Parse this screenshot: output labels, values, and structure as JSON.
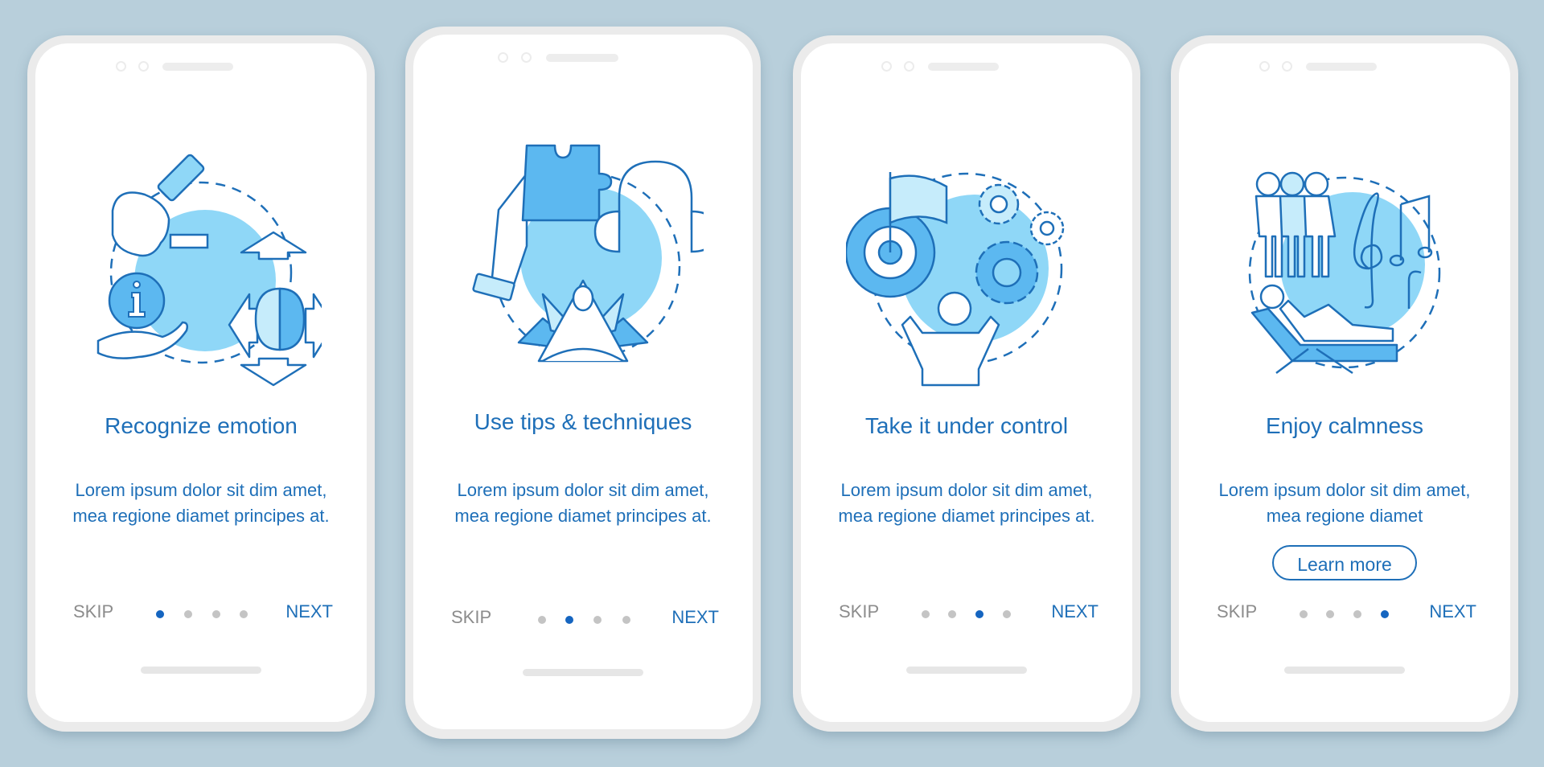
{
  "colors": {
    "background": "#b8cfdb",
    "accent": "#1e6fb8",
    "active_dot": "#1565c0",
    "inactive_dot": "#c4c4c4",
    "skip": "#8c8c8c",
    "illustration_fill": "#8fd7f7",
    "illustration_mid": "#5cb8f0"
  },
  "screens": [
    {
      "illustration": "recognize-emotion-illustration",
      "title": "Recognize emotion",
      "description": "Lorem ipsum dolor sit dim amet, mea regione diamet principes at.",
      "skip_label": "SKIP",
      "next_label": "NEXT",
      "page_index": 1,
      "page_count": 4
    },
    {
      "illustration": "tips-techniques-illustration",
      "title": "Use tips & techniques",
      "description": "Lorem ipsum dolor sit dim amet, mea regione diamet principes at.",
      "skip_label": "SKIP",
      "next_label": "NEXT",
      "page_index": 2,
      "page_count": 4
    },
    {
      "illustration": "take-control-illustration",
      "title": "Take it under control",
      "description": "Lorem ipsum dolor sit dim amet, mea regione diamet principes at.",
      "skip_label": "SKIP",
      "next_label": "NEXT",
      "page_index": 3,
      "page_count": 4
    },
    {
      "illustration": "enjoy-calmness-illustration",
      "title": "Enjoy calmness",
      "description": "Lorem ipsum dolor sit dim amet, mea regione diamet",
      "learn_more_label": "Learn more",
      "skip_label": "SKIP",
      "next_label": "NEXT",
      "page_index": 4,
      "page_count": 4
    }
  ]
}
